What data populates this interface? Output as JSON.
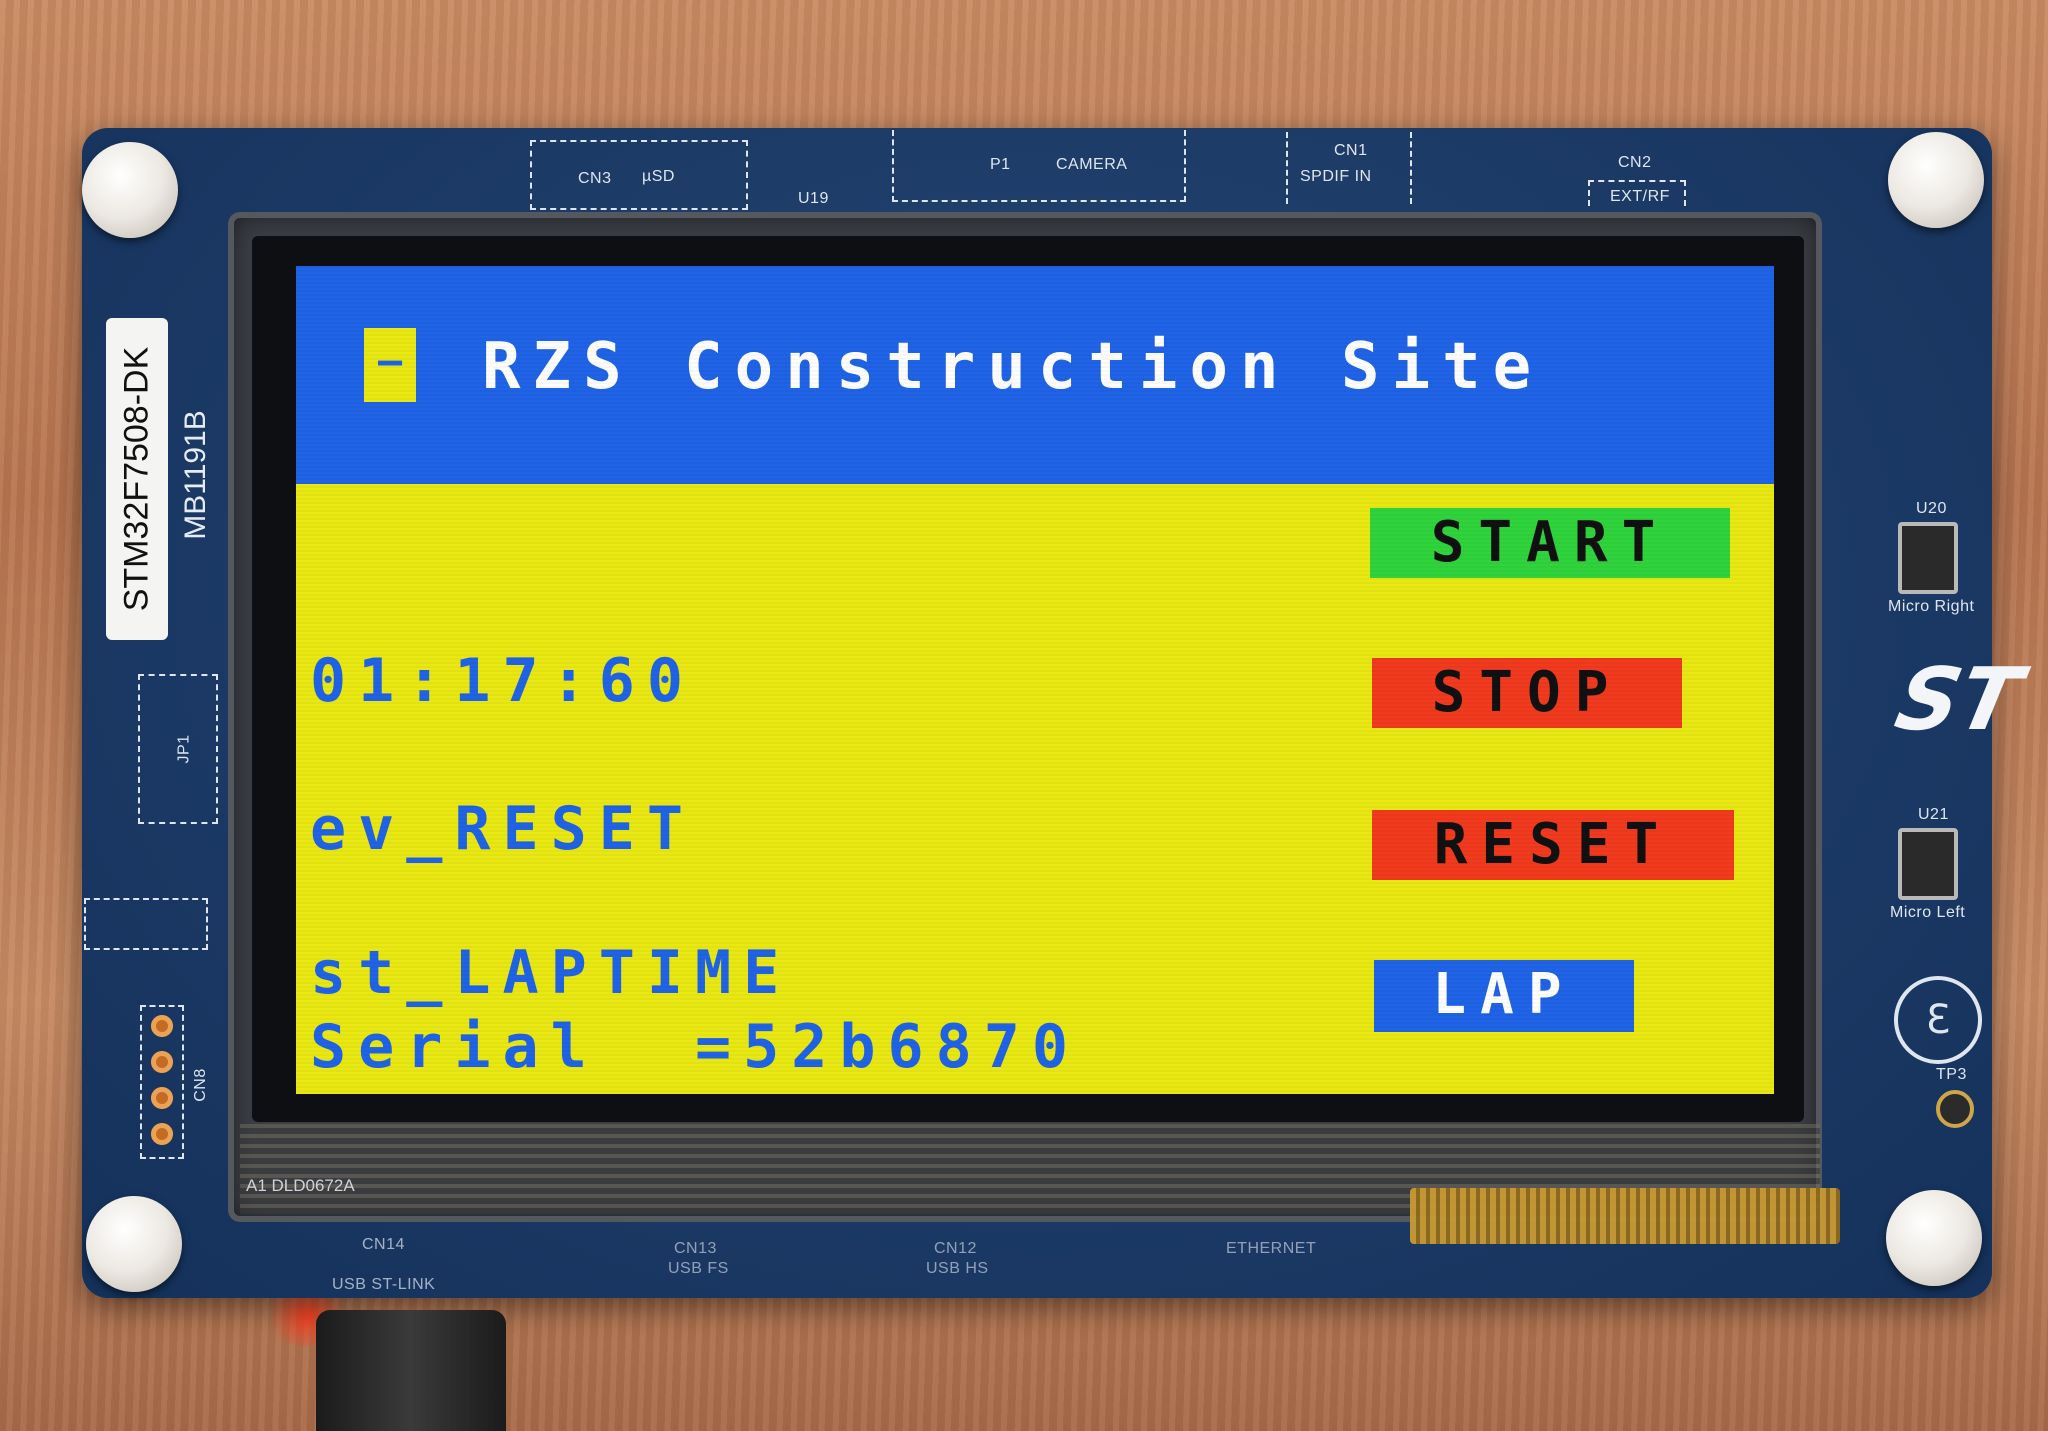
{
  "board": {
    "model_label": "STM32F7508-DK",
    "board_id": "MB1191B",
    "silkscreen": {
      "cn3": "CN3",
      "usd": "µSD",
      "u19": "U19",
      "p1": "P1",
      "camera": "CAMERA",
      "cn1": "CN1",
      "spdif_in": "SPDIF IN",
      "cn2": "CN2",
      "ext_rf": "EXT/RF",
      "u20": "U20",
      "micro_right": "Micro Right",
      "u21": "U21",
      "micro_left": "Micro Left",
      "tp3": "TP3",
      "jp1": "JP1",
      "cn8": "CN8",
      "cn14": "CN14",
      "usb_st_link": "USB ST-LINK",
      "cn13": "CN13",
      "usb_fs": "USB FS",
      "cn12": "CN12",
      "usb_hs": "USB HS",
      "ethernet": "ETHERNET",
      "panel_code": "A1 DLD0672A"
    },
    "logo_text": "ST",
    "ce_mark": "Ɛ"
  },
  "screen": {
    "menu_button_glyph": "–",
    "title": "RZS Construction Site",
    "time_display": "01:17:60",
    "event_text": "ev_RESET",
    "state_text": "st_LAPTIME",
    "serial_text": "Serial  =52b6870",
    "buttons": {
      "start": "START",
      "stop": "STOP",
      "reset": "RESET",
      "lap": "LAP"
    },
    "colors": {
      "header_blue": "#1f63e6",
      "body_yellow": "#e9e812",
      "start_green": "#2fd43c",
      "stop_red": "#f23a1e",
      "lap_blue": "#1f63e6"
    }
  }
}
